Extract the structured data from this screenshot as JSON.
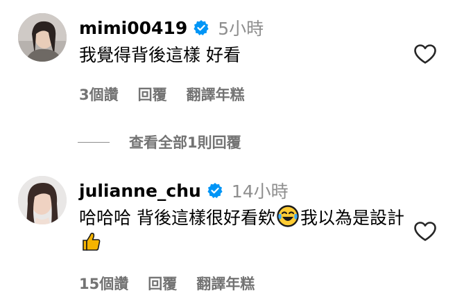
{
  "comments": [
    {
      "username": "mimi00419",
      "verified": true,
      "time": "5小時",
      "text": "我覺得背後這樣 好看",
      "likes": "3個讚",
      "reply_label": "回覆",
      "translate_label": "翻譯年糕"
    },
    {
      "username": "julianne_chu",
      "verified": true,
      "time": "14小時",
      "text_part1": "哈哈哈 背後這樣很好看欸",
      "emoji1": "face-with-tears-of-joy-emoji",
      "text_part2": "我以為是設計",
      "emoji2": "thumbs-up-emoji",
      "likes": "15個讚",
      "reply_label": "回覆",
      "translate_label": "翻譯年糕"
    }
  ],
  "view_replies_label": "查看全部1則回覆",
  "colors": {
    "verified_badge": "#0095f6",
    "secondary_text": "#737373",
    "timestamp": "#8e8e8e",
    "primary_text": "#000000"
  },
  "icons": {
    "like": "heart-outline-icon",
    "verified": "verified-badge-icon"
  }
}
